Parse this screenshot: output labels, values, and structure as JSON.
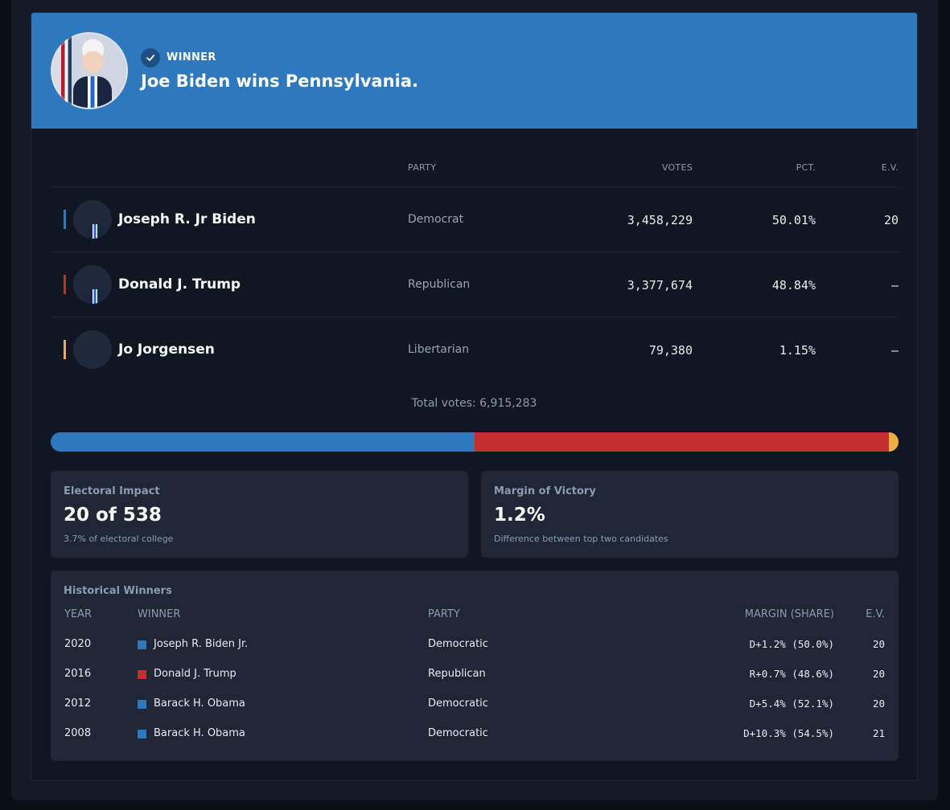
{
  "banner": {
    "status_label": "WINNER",
    "headline": "Joe Biden wins Pennsylvania."
  },
  "results_table": {
    "headers": {
      "party": "PARTY",
      "votes": "VOTES",
      "pct": "PCT.",
      "ev": "E.V."
    },
    "rows": [
      {
        "name": "Joseph R. Jr Biden",
        "party": "Democrat",
        "votes": "3,458,229",
        "pct": "50.01%",
        "ev": "20",
        "color": "#2e78be"
      },
      {
        "name": "Donald J. Trump",
        "party": "Republican",
        "votes": "3,377,674",
        "pct": "48.84%",
        "ev": "—",
        "color": "#c12f30"
      },
      {
        "name": "Jo Jorgensen",
        "party": "Libertarian",
        "votes": "79,380",
        "pct": "1.15%",
        "ev": "—",
        "color": "#f0ad43"
      }
    ],
    "total": "Total votes: 6,915,283"
  },
  "vote_share_bar": {
    "segments": [
      {
        "party": "Democrat",
        "share": 50.01,
        "color": "#2e78be"
      },
      {
        "party": "Republican",
        "share": 48.84,
        "color": "#c12f30"
      },
      {
        "party": "Libertarian",
        "share": 1.15,
        "color": "#f0ad43"
      }
    ]
  },
  "electoral_impact": {
    "label": "Electoral Impact",
    "value": "20 of 538",
    "sub": "3.7% of electoral college"
  },
  "margin_of_victory": {
    "label": "Margin of Victory",
    "value": "1.2%",
    "sub": "Difference between top two candidates"
  },
  "historical": {
    "title": "Historical Winners",
    "headers": {
      "year": "YEAR",
      "winner": "WINNER",
      "party": "PARTY",
      "margin": "MARGIN (SHARE)",
      "ev": "E.V."
    },
    "rows": [
      {
        "year": "2020",
        "winner": "Joseph R. Biden Jr.",
        "party": "Democratic",
        "margin": "D+1.2% (50.0%)",
        "ev": "20",
        "color": "#2e78be"
      },
      {
        "year": "2016",
        "winner": "Donald J. Trump",
        "party": "Republican",
        "margin": "R+0.7% (48.6%)",
        "ev": "20",
        "color": "#c12f30"
      },
      {
        "year": "2012",
        "winner": "Barack H. Obama",
        "party": "Democratic",
        "margin": "D+5.4% (52.1%)",
        "ev": "20",
        "color": "#2e78be"
      },
      {
        "year": "2008",
        "winner": "Barack H. Obama",
        "party": "Democratic",
        "margin": "D+10.3% (54.5%)",
        "ev": "21",
        "color": "#2e78be"
      }
    ]
  }
}
